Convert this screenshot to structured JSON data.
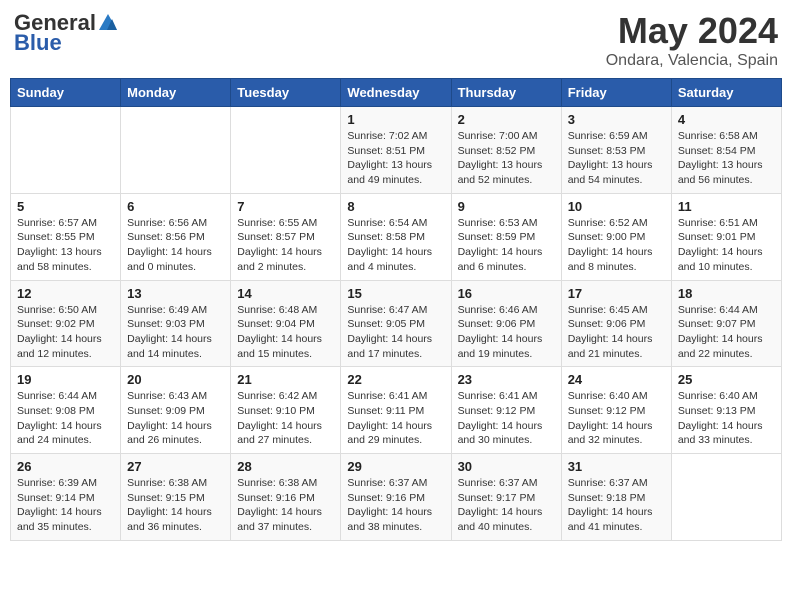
{
  "header": {
    "logo_general": "General",
    "logo_blue": "Blue",
    "month": "May 2024",
    "location": "Ondara, Valencia, Spain"
  },
  "weekdays": [
    "Sunday",
    "Monday",
    "Tuesday",
    "Wednesday",
    "Thursday",
    "Friday",
    "Saturday"
  ],
  "weeks": [
    [
      {
        "day": "",
        "info": ""
      },
      {
        "day": "",
        "info": ""
      },
      {
        "day": "",
        "info": ""
      },
      {
        "day": "1",
        "info": "Sunrise: 7:02 AM\nSunset: 8:51 PM\nDaylight: 13 hours\nand 49 minutes."
      },
      {
        "day": "2",
        "info": "Sunrise: 7:00 AM\nSunset: 8:52 PM\nDaylight: 13 hours\nand 52 minutes."
      },
      {
        "day": "3",
        "info": "Sunrise: 6:59 AM\nSunset: 8:53 PM\nDaylight: 13 hours\nand 54 minutes."
      },
      {
        "day": "4",
        "info": "Sunrise: 6:58 AM\nSunset: 8:54 PM\nDaylight: 13 hours\nand 56 minutes."
      }
    ],
    [
      {
        "day": "5",
        "info": "Sunrise: 6:57 AM\nSunset: 8:55 PM\nDaylight: 13 hours\nand 58 minutes."
      },
      {
        "day": "6",
        "info": "Sunrise: 6:56 AM\nSunset: 8:56 PM\nDaylight: 14 hours\nand 0 minutes."
      },
      {
        "day": "7",
        "info": "Sunrise: 6:55 AM\nSunset: 8:57 PM\nDaylight: 14 hours\nand 2 minutes."
      },
      {
        "day": "8",
        "info": "Sunrise: 6:54 AM\nSunset: 8:58 PM\nDaylight: 14 hours\nand 4 minutes."
      },
      {
        "day": "9",
        "info": "Sunrise: 6:53 AM\nSunset: 8:59 PM\nDaylight: 14 hours\nand 6 minutes."
      },
      {
        "day": "10",
        "info": "Sunrise: 6:52 AM\nSunset: 9:00 PM\nDaylight: 14 hours\nand 8 minutes."
      },
      {
        "day": "11",
        "info": "Sunrise: 6:51 AM\nSunset: 9:01 PM\nDaylight: 14 hours\nand 10 minutes."
      }
    ],
    [
      {
        "day": "12",
        "info": "Sunrise: 6:50 AM\nSunset: 9:02 PM\nDaylight: 14 hours\nand 12 minutes."
      },
      {
        "day": "13",
        "info": "Sunrise: 6:49 AM\nSunset: 9:03 PM\nDaylight: 14 hours\nand 14 minutes."
      },
      {
        "day": "14",
        "info": "Sunrise: 6:48 AM\nSunset: 9:04 PM\nDaylight: 14 hours\nand 15 minutes."
      },
      {
        "day": "15",
        "info": "Sunrise: 6:47 AM\nSunset: 9:05 PM\nDaylight: 14 hours\nand 17 minutes."
      },
      {
        "day": "16",
        "info": "Sunrise: 6:46 AM\nSunset: 9:06 PM\nDaylight: 14 hours\nand 19 minutes."
      },
      {
        "day": "17",
        "info": "Sunrise: 6:45 AM\nSunset: 9:06 PM\nDaylight: 14 hours\nand 21 minutes."
      },
      {
        "day": "18",
        "info": "Sunrise: 6:44 AM\nSunset: 9:07 PM\nDaylight: 14 hours\nand 22 minutes."
      }
    ],
    [
      {
        "day": "19",
        "info": "Sunrise: 6:44 AM\nSunset: 9:08 PM\nDaylight: 14 hours\nand 24 minutes."
      },
      {
        "day": "20",
        "info": "Sunrise: 6:43 AM\nSunset: 9:09 PM\nDaylight: 14 hours\nand 26 minutes."
      },
      {
        "day": "21",
        "info": "Sunrise: 6:42 AM\nSunset: 9:10 PM\nDaylight: 14 hours\nand 27 minutes."
      },
      {
        "day": "22",
        "info": "Sunrise: 6:41 AM\nSunset: 9:11 PM\nDaylight: 14 hours\nand 29 minutes."
      },
      {
        "day": "23",
        "info": "Sunrise: 6:41 AM\nSunset: 9:12 PM\nDaylight: 14 hours\nand 30 minutes."
      },
      {
        "day": "24",
        "info": "Sunrise: 6:40 AM\nSunset: 9:12 PM\nDaylight: 14 hours\nand 32 minutes."
      },
      {
        "day": "25",
        "info": "Sunrise: 6:40 AM\nSunset: 9:13 PM\nDaylight: 14 hours\nand 33 minutes."
      }
    ],
    [
      {
        "day": "26",
        "info": "Sunrise: 6:39 AM\nSunset: 9:14 PM\nDaylight: 14 hours\nand 35 minutes."
      },
      {
        "day": "27",
        "info": "Sunrise: 6:38 AM\nSunset: 9:15 PM\nDaylight: 14 hours\nand 36 minutes."
      },
      {
        "day": "28",
        "info": "Sunrise: 6:38 AM\nSunset: 9:16 PM\nDaylight: 14 hours\nand 37 minutes."
      },
      {
        "day": "29",
        "info": "Sunrise: 6:37 AM\nSunset: 9:16 PM\nDaylight: 14 hours\nand 38 minutes."
      },
      {
        "day": "30",
        "info": "Sunrise: 6:37 AM\nSunset: 9:17 PM\nDaylight: 14 hours\nand 40 minutes."
      },
      {
        "day": "31",
        "info": "Sunrise: 6:37 AM\nSunset: 9:18 PM\nDaylight: 14 hours\nand 41 minutes."
      },
      {
        "day": "",
        "info": ""
      }
    ]
  ]
}
